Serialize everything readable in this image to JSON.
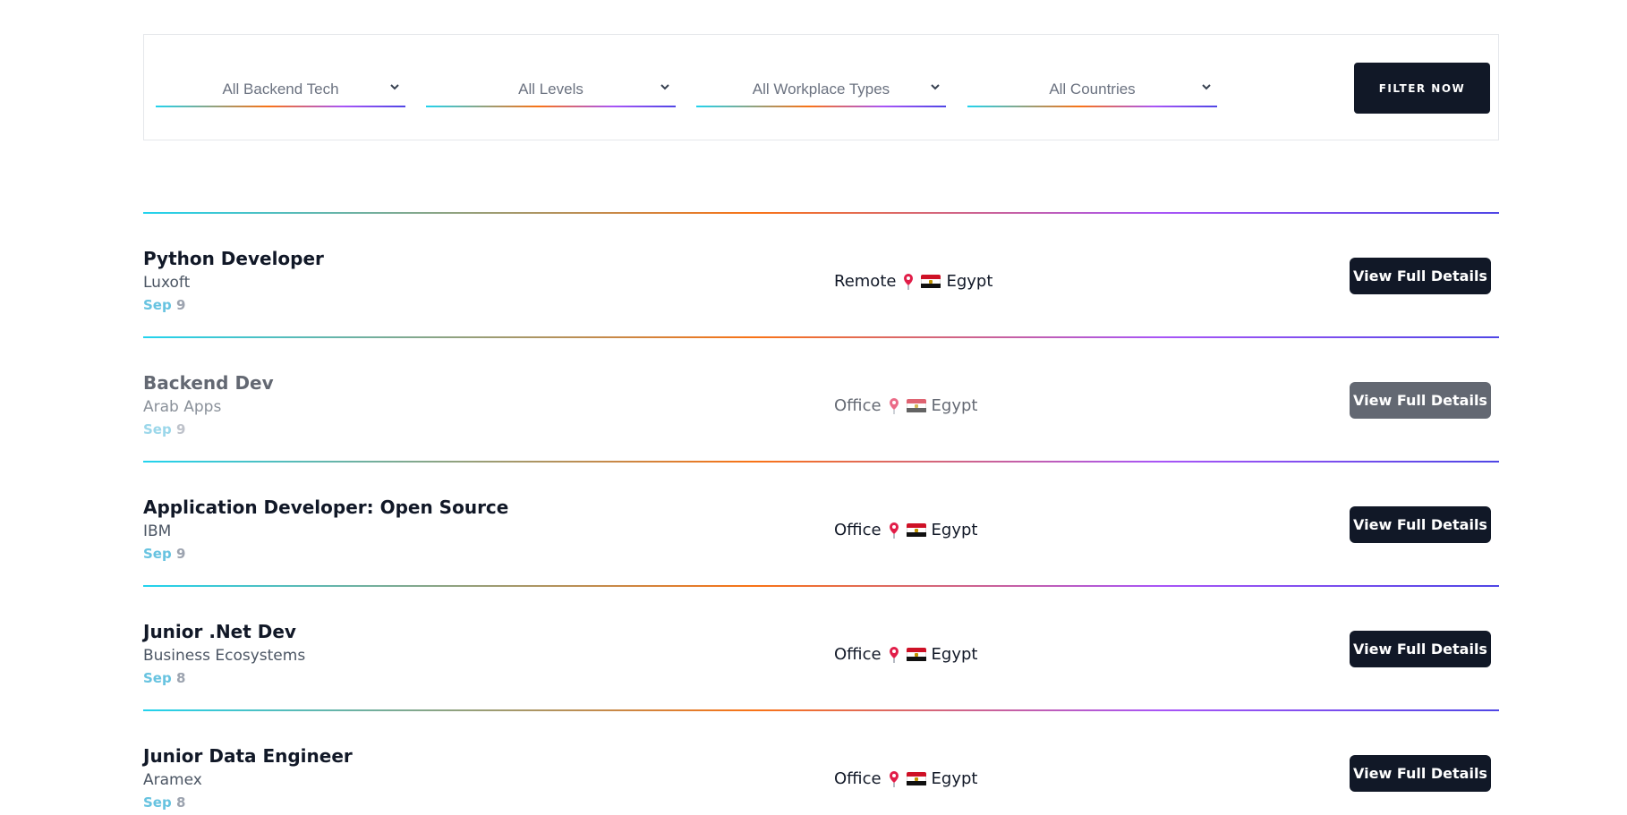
{
  "filters": {
    "backend_tech": "All Backend Tech",
    "levels": "All Levels",
    "workplace_types": "All Workplace Types",
    "countries": "All Countries",
    "submit_label": "FILTER NOW"
  },
  "jobs": [
    {
      "title": "Python Developer",
      "company": "Luxoft",
      "date_month": "Sep",
      "date_day": "9",
      "workplace": "Remote",
      "country": "Egypt",
      "action": "View Full Details"
    },
    {
      "title": "Backend Dev",
      "company": "Arab Apps",
      "date_month": "Sep",
      "date_day": "9",
      "workplace": "Office",
      "country": "Egypt",
      "action": "View Full Details"
    },
    {
      "title": "Application Developer: Open Source",
      "company": "IBM",
      "date_month": "Sep",
      "date_day": "9",
      "workplace": "Office",
      "country": "Egypt",
      "action": "View Full Details"
    },
    {
      "title": "Junior .Net Dev",
      "company": "Business Ecosystems",
      "date_month": "Sep",
      "date_day": "8",
      "workplace": "Office",
      "country": "Egypt",
      "action": "View Full Details"
    },
    {
      "title": "Junior Data Engineer",
      "company": "Aramex",
      "date_month": "Sep",
      "date_day": "8",
      "workplace": "Office",
      "country": "Egypt",
      "action": "View Full Details"
    }
  ],
  "icons": {
    "location": "pin-icon",
    "country_flag": "egypt-flag-icon",
    "dropdown": "chevron-down-icon"
  },
  "colors": {
    "primary_button": "#111827",
    "date_month": "#67c3e0",
    "gradient": [
      "#22d3ee",
      "#f97316",
      "#a855f7",
      "#4f46e5"
    ]
  }
}
